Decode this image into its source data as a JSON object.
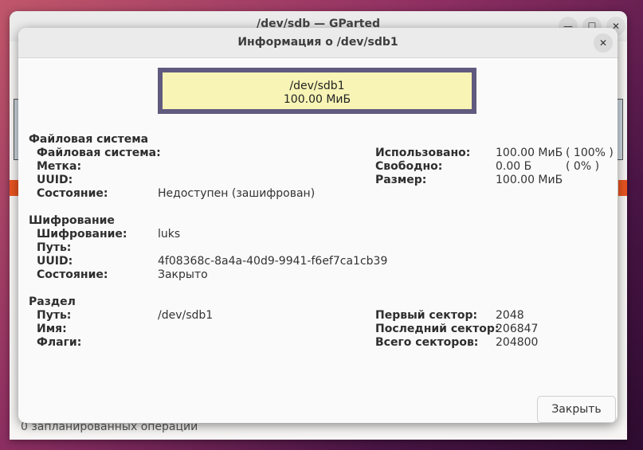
{
  "main_window": {
    "title": "/dev/sdb — GParted",
    "status_text": "0 запланированных операций",
    "buttons": {
      "minimize": "—",
      "maximize": "☐",
      "close": "✕"
    }
  },
  "dialog": {
    "title": "Информация о /dev/sdb1",
    "close_icon": "✕",
    "partition_graphic": {
      "name": "/dev/sdb1",
      "size": "100.00 МиБ"
    },
    "filesystem_section": {
      "title": "Файловая система",
      "labels": {
        "filesystem": "Файловая система:",
        "label": "Метка:",
        "uuid": "UUID:",
        "state": "Состояние:",
        "used": "Использовано:",
        "free": "Свободно:",
        "size": "Размер:"
      },
      "values": {
        "filesystem": "",
        "label": "",
        "uuid": "",
        "state": "Недоступен (зашифрован)",
        "used": "100.00 МиБ",
        "used_percent": "( 100% )",
        "free": "0.00 Б",
        "free_percent": "( 0% )",
        "size": "100.00 МиБ"
      }
    },
    "encryption_section": {
      "title": "Шифрование",
      "labels": {
        "encryption": "Шифрование:",
        "paths": "Путь:",
        "uuid": "UUID:",
        "state": "Состояние:"
      },
      "values": {
        "encryption": "luks",
        "paths": "",
        "uuid": "4f08368c-8a4a-40d9-9941-f6ef7ca1cb39",
        "state": "Закрыто"
      }
    },
    "partition_section": {
      "title": "Раздел",
      "labels": {
        "path": "Путь:",
        "name": "Имя:",
        "flags": "Флаги:",
        "first_sector": "Первый сектор:",
        "last_sector": "Последний сектор:",
        "total_sectors": "Всего секторов:"
      },
      "values": {
        "path": "/dev/sdb1",
        "name": "",
        "flags": "",
        "first_sector": "2048",
        "last_sector": "206847",
        "total_sectors": "204800"
      }
    },
    "close_button_label": "Закрыть"
  }
}
